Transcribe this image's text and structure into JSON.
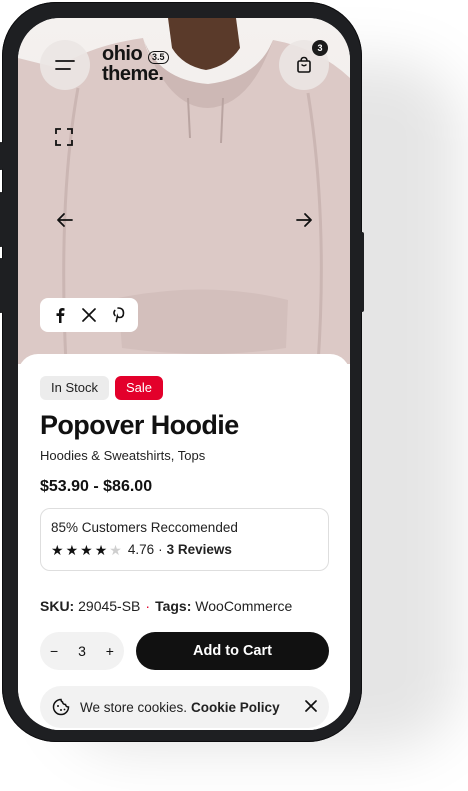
{
  "header": {
    "logo_line1": "ohio",
    "logo_line2": "theme.",
    "version": "3.5",
    "cart_count": "3"
  },
  "icons": {
    "menu": "menu-icon",
    "cart": "shopping-bag-icon",
    "fullscreen": "fullscreen-icon",
    "prev": "arrow-left-icon",
    "next": "arrow-right-icon",
    "social": [
      "facebook-icon",
      "x-icon",
      "pinterest-icon"
    ]
  },
  "product": {
    "badges": {
      "stock": "In Stock",
      "sale": "Sale"
    },
    "title": "Popover Hoodie",
    "categories": "Hoodies & Sweatshirts, Tops",
    "price": "$53.90 - $86.00",
    "recommend": "85% Customers Reccomended",
    "rating": 4.76,
    "rating_text": "4.76",
    "rating_sep": "·",
    "reviews": "3 Reviews",
    "sku_label": "SKU:",
    "sku": "29045-SB",
    "tags_label": "Tags:",
    "tags": "WooCommerce"
  },
  "cart": {
    "quantity": "3",
    "minus": "−",
    "plus": "+",
    "add_label": "Add to Cart"
  },
  "cookie": {
    "text": "We store cookies.",
    "link": "Cookie Policy"
  },
  "colors": {
    "accent": "#e3002b",
    "dark": "#111111",
    "hoodie": "#dcc9c6"
  }
}
